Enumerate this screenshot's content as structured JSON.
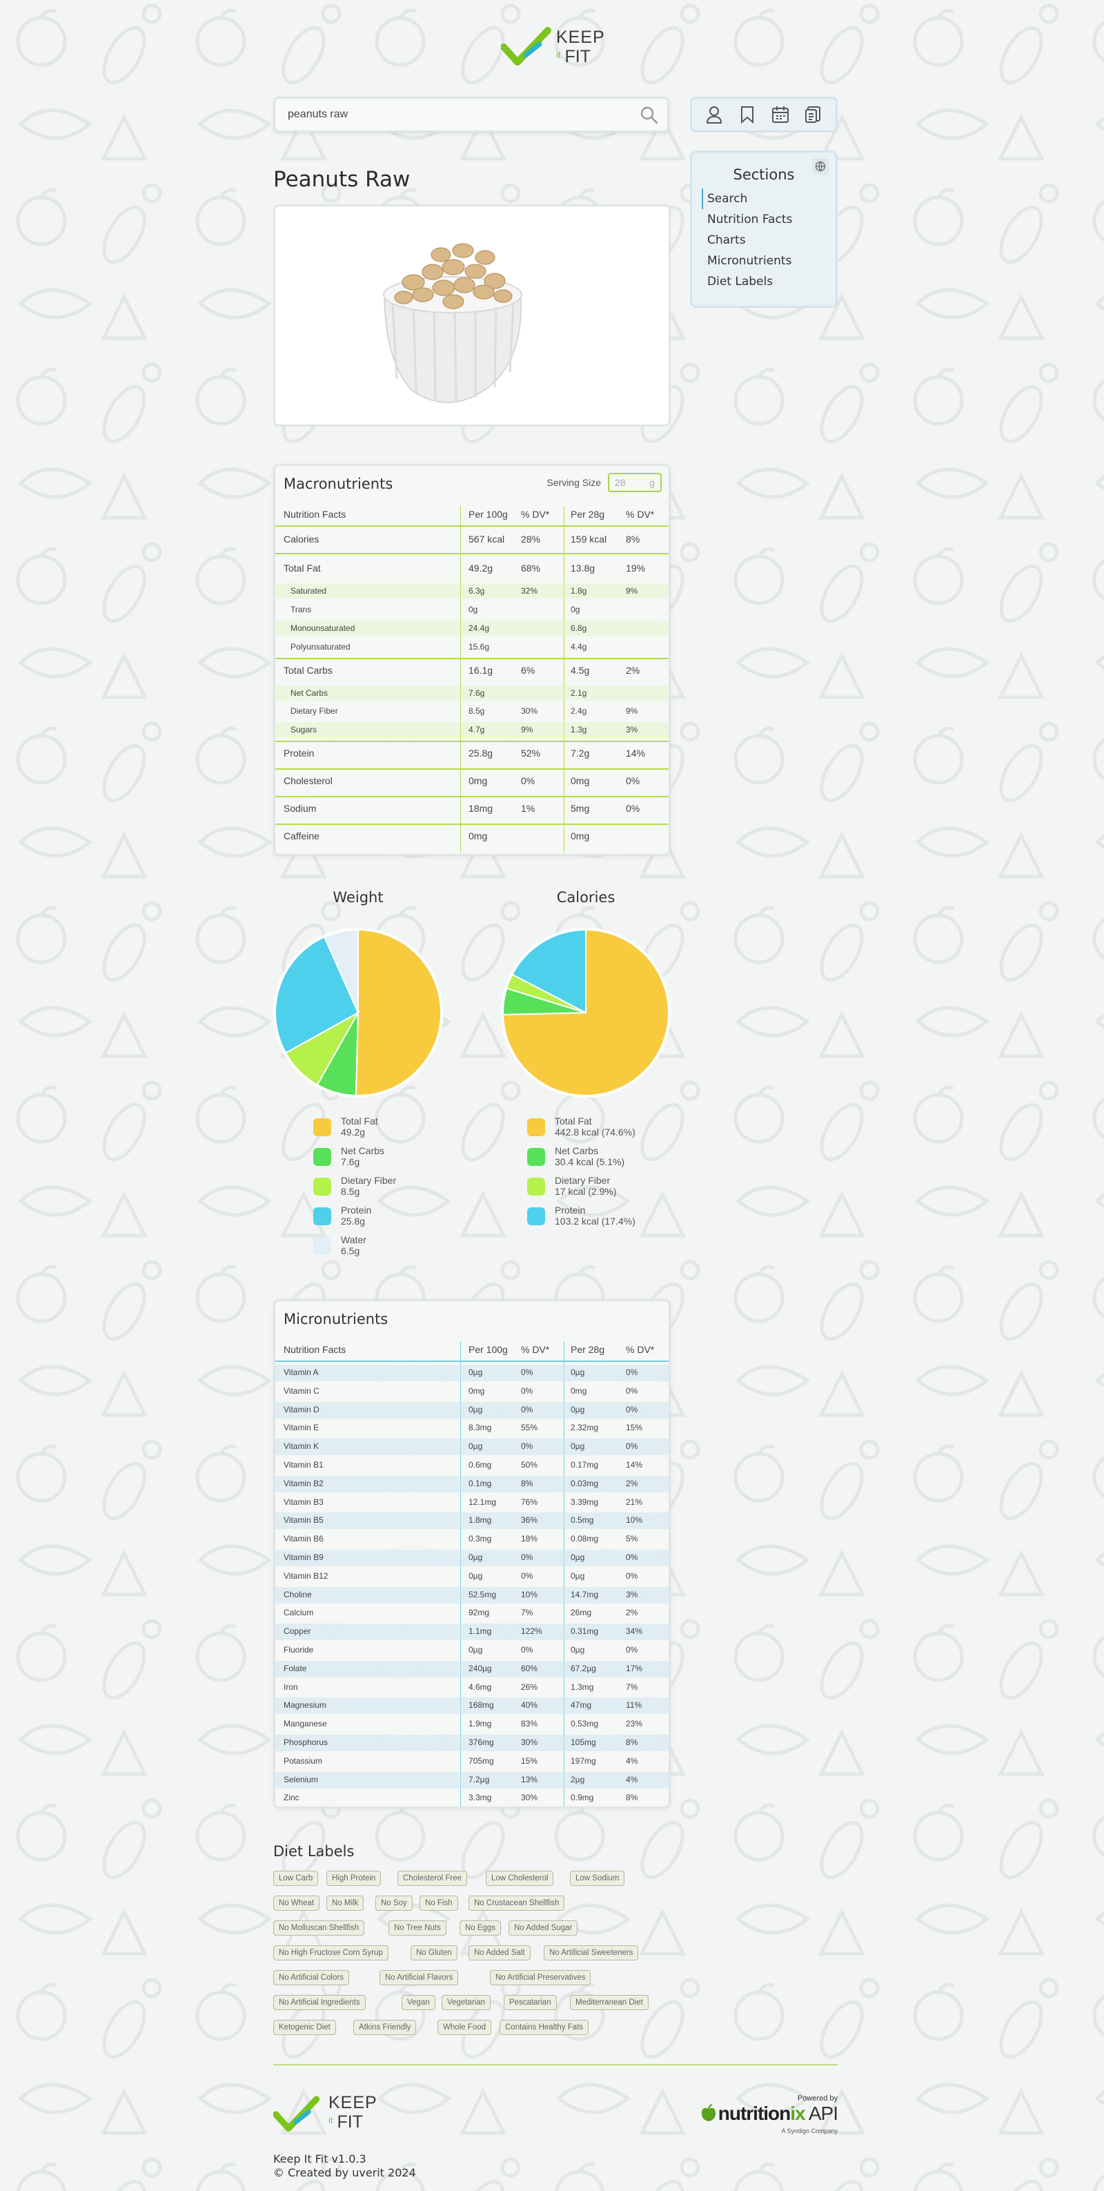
{
  "header": {
    "logo_line1": "KEEP",
    "logo_it": "it",
    "logo_line2": "FIT"
  },
  "search": {
    "value": "peanuts raw"
  },
  "toolbar": {
    "icons": [
      "user-icon",
      "bookmark-icon",
      "calendar-icon",
      "document-icon"
    ]
  },
  "sections": {
    "title": "Sections",
    "items": [
      "Search",
      "Nutrition Facts",
      "Charts",
      "Micronutrients",
      "Diet Labels"
    ]
  },
  "food": {
    "title": "Peanuts Raw"
  },
  "macros": {
    "title": "Macronutrients",
    "serving_label": "Serving Size",
    "serving_value": "28",
    "serving_unit": "g",
    "header": [
      "Nutrition Facts",
      "Per 100g",
      "% DV*",
      "Per 28g",
      "% DV*"
    ],
    "rows": [
      {
        "name": "Calories",
        "v100": "567 kcal",
        "dv100": "28%",
        "vs": "159 kcal",
        "dvs": "8%"
      },
      {
        "name": "Total Fat",
        "v100": "49.2g",
        "dv100": "68%",
        "vs": "13.8g",
        "dvs": "19%"
      },
      {
        "name": "Saturated",
        "v100": "6.3g",
        "dv100": "32%",
        "vs": "1.8g",
        "dvs": "9%"
      },
      {
        "name": "Trans",
        "v100": "0g",
        "dv100": "",
        "vs": "0g",
        "dvs": ""
      },
      {
        "name": "Monounsaturated",
        "v100": "24.4g",
        "dv100": "",
        "vs": "6.8g",
        "dvs": ""
      },
      {
        "name": "Polyunsaturated",
        "v100": "15.6g",
        "dv100": "",
        "vs": "4.4g",
        "dvs": ""
      },
      {
        "name": "Total Carbs",
        "v100": "16.1g",
        "dv100": "6%",
        "vs": "4.5g",
        "dvs": "2%"
      },
      {
        "name": "Net Carbs",
        "v100": "7.6g",
        "dv100": "",
        "vs": "2.1g",
        "dvs": ""
      },
      {
        "name": "Dietary Fiber",
        "v100": "8.5g",
        "dv100": "30%",
        "vs": "2.4g",
        "dvs": "9%"
      },
      {
        "name": "Sugars",
        "v100": "4.7g",
        "dv100": "9%",
        "vs": "1.3g",
        "dvs": "3%"
      },
      {
        "name": "Protein",
        "v100": "25.8g",
        "dv100": "52%",
        "vs": "7.2g",
        "dvs": "14%"
      },
      {
        "name": "Cholesterol",
        "v100": "0mg",
        "dv100": "0%",
        "vs": "0mg",
        "dvs": "0%"
      },
      {
        "name": "Sodium",
        "v100": "18mg",
        "dv100": "1%",
        "vs": "5mg",
        "dvs": "0%"
      },
      {
        "name": "Caffeine",
        "v100": "0mg",
        "dv100": "",
        "vs": "0mg",
        "dvs": ""
      }
    ]
  },
  "chart_data": [
    {
      "type": "pie",
      "title": "Weight",
      "categories": [
        "Total Fat",
        "Net Carbs",
        "Dietary Fiber",
        "Protein",
        "Water"
      ],
      "values": [
        49.2,
        7.6,
        8.5,
        25.8,
        6.5
      ],
      "legend": [
        "49.2g",
        "7.6g",
        "8.5g",
        "25.8g",
        "6.5g"
      ],
      "colors": [
        "#f7cb3d",
        "#58e05a",
        "#b6f04b",
        "#4ed0ec",
        "#e3eef6"
      ]
    },
    {
      "type": "pie",
      "title": "Calories",
      "categories": [
        "Total Fat",
        "Net Carbs",
        "Dietary Fiber",
        "Protein"
      ],
      "values": [
        442.8,
        30.4,
        17,
        103.2
      ],
      "legend": [
        "442.8 kcal (74.6%)",
        "30.4 kcal (5.1%)",
        "17 kcal (2.9%)",
        "103.2 kcal (17.4%)"
      ],
      "colors": [
        "#f7cb3d",
        "#58e05a",
        "#b6f04b",
        "#4ed0ec"
      ]
    }
  ],
  "micros": {
    "title": "Micronutrients",
    "header": [
      "Nutrition Facts",
      "Per 100g",
      "% DV*",
      "Per 28g",
      "% DV*"
    ],
    "rows": [
      {
        "name": "Vitamin A",
        "v100": "0µg",
        "dv100": "0%",
        "vs": "0µg",
        "dvs": "0%"
      },
      {
        "name": "Vitamin C",
        "v100": "0mg",
        "dv100": "0%",
        "vs": "0mg",
        "dvs": "0%"
      },
      {
        "name": "Vitamin D",
        "v100": "0µg",
        "dv100": "0%",
        "vs": "0µg",
        "dvs": "0%"
      },
      {
        "name": "Vitamin E",
        "v100": "8.3mg",
        "dv100": "55%",
        "vs": "2.32mg",
        "dvs": "15%"
      },
      {
        "name": "Vitamin K",
        "v100": "0µg",
        "dv100": "0%",
        "vs": "0µg",
        "dvs": "0%"
      },
      {
        "name": "Vitamin B1",
        "v100": "0.6mg",
        "dv100": "50%",
        "vs": "0.17mg",
        "dvs": "14%"
      },
      {
        "name": "Vitamin B2",
        "v100": "0.1mg",
        "dv100": "8%",
        "vs": "0.03mg",
        "dvs": "2%"
      },
      {
        "name": "Vitamin B3",
        "v100": "12.1mg",
        "dv100": "76%",
        "vs": "3.39mg",
        "dvs": "21%"
      },
      {
        "name": "Vitamin B5",
        "v100": "1.8mg",
        "dv100": "36%",
        "vs": "0.5mg",
        "dvs": "10%"
      },
      {
        "name": "Vitamin B6",
        "v100": "0.3mg",
        "dv100": "18%",
        "vs": "0.08mg",
        "dvs": "5%"
      },
      {
        "name": "Vitamin B9",
        "v100": "0µg",
        "dv100": "0%",
        "vs": "0µg",
        "dvs": "0%"
      },
      {
        "name": "Vitamin B12",
        "v100": "0µg",
        "dv100": "0%",
        "vs": "0µg",
        "dvs": "0%"
      },
      {
        "name": "Choline",
        "v100": "52.5mg",
        "dv100": "10%",
        "vs": "14.7mg",
        "dvs": "3%"
      },
      {
        "name": "Calcium",
        "v100": "92mg",
        "dv100": "7%",
        "vs": "26mg",
        "dvs": "2%"
      },
      {
        "name": "Copper",
        "v100": "1.1mg",
        "dv100": "122%",
        "vs": "0.31mg",
        "dvs": "34%"
      },
      {
        "name": "Fluoride",
        "v100": "0µg",
        "dv100": "0%",
        "vs": "0µg",
        "dvs": "0%"
      },
      {
        "name": "Folate",
        "v100": "240µg",
        "dv100": "60%",
        "vs": "67.2µg",
        "dvs": "17%"
      },
      {
        "name": "Iron",
        "v100": "4.6mg",
        "dv100": "26%",
        "vs": "1.3mg",
        "dvs": "7%"
      },
      {
        "name": "Magnesium",
        "v100": "168mg",
        "dv100": "40%",
        "vs": "47mg",
        "dvs": "11%"
      },
      {
        "name": "Manganese",
        "v100": "1.9mg",
        "dv100": "83%",
        "vs": "0.53mg",
        "dvs": "23%"
      },
      {
        "name": "Phosphorus",
        "v100": "376mg",
        "dv100": "30%",
        "vs": "105mg",
        "dvs": "8%"
      },
      {
        "name": "Potassium",
        "v100": "705mg",
        "dv100": "15%",
        "vs": "197mg",
        "dvs": "4%"
      },
      {
        "name": "Selenium",
        "v100": "7.2µg",
        "dv100": "13%",
        "vs": "2µg",
        "dvs": "4%"
      },
      {
        "name": "Zinc",
        "v100": "3.3mg",
        "dv100": "30%",
        "vs": "0.9mg",
        "dvs": "8%"
      }
    ]
  },
  "diet_labels": {
    "title": "Diet Labels",
    "rows": [
      [
        "Low Carb",
        "High Protein",
        "Cholesterol Free",
        "Low Cholesterol",
        "Low Sodium"
      ],
      [
        "No Wheat",
        "No Milk",
        "No Soy",
        "No Fish",
        "No Crustacean Shellfish"
      ],
      [
        "No Molluscan Shellfish",
        "No Tree Nuts",
        "No Eggs",
        "No Added Sugar"
      ],
      [
        "No High Fructose Corn Syrup",
        "No Gluten",
        "No Added Salt",
        "No Artificial Sweeteners"
      ],
      [
        "No Artificial Colors",
        "No Artificial Flavors",
        "No Artificial Preservatives"
      ],
      [
        "No Artificial Ingredients",
        "Vegan",
        "Vegetarian",
        "Pescatarian",
        "Mediterranean Diet"
      ],
      [
        "Ketogenic Diet",
        "Atkins Friendly",
        "Whole Food",
        "Contains Healthy Fats"
      ]
    ]
  },
  "footer": {
    "version": "Keep It Fit v1.0.3",
    "credit": "© Created by uverit 2024",
    "powered_by": "Powered by",
    "api_name_a": "nutrition",
    "api_name_b": "ix",
    "api_name_c": " API",
    "api_sub": "A Syndigo Company"
  }
}
